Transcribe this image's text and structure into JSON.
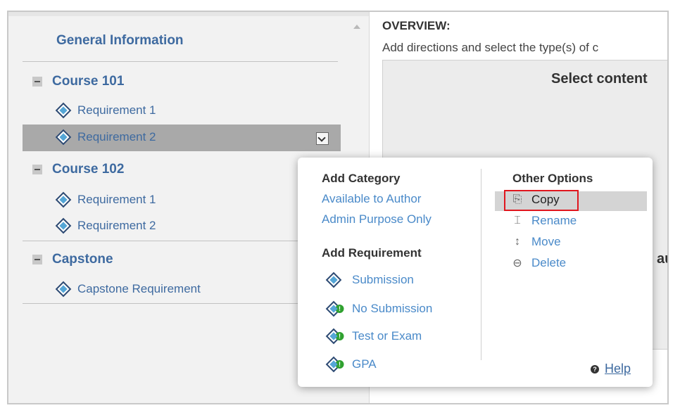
{
  "tree": {
    "general_info": "General Information",
    "categories": [
      {
        "label": "Course 101",
        "items": [
          "Requirement 1",
          "Requirement 2"
        ]
      },
      {
        "label": "Course 102",
        "items": [
          "Requirement 1",
          "Requirement 2"
        ]
      },
      {
        "label": "Capstone",
        "items": [
          "Capstone Requirement"
        ]
      }
    ],
    "selected_item": "Requirement 2"
  },
  "overview": {
    "title": "OVERVIEW:",
    "description": "Add directions and select the type(s) of c",
    "box_heading": "Select content",
    "partial_text": "au"
  },
  "popup": {
    "add_category": {
      "heading": "Add Category",
      "links": [
        "Available to Author",
        "Admin Purpose Only"
      ]
    },
    "add_requirement": {
      "heading": "Add Requirement",
      "items": [
        "Submission",
        "No Submission",
        "Test or Exam",
        "GPA"
      ]
    },
    "other_options": {
      "heading": "Other Options",
      "items": [
        "Copy",
        "Rename",
        "Move",
        "Delete"
      ]
    },
    "help_label": "Help"
  },
  "colors": {
    "link": "#4a8ac9",
    "tree_text": "#3e6aa0",
    "highlight": "#e0161e",
    "selected_row": "#a9a9a9"
  }
}
